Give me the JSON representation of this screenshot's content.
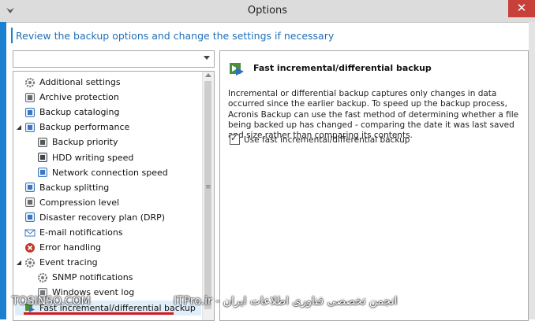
{
  "window": {
    "title": "Options",
    "close_glyph": "✕"
  },
  "header": {
    "text": "Review the backup options and change the settings if necessary"
  },
  "combo": {
    "value": ""
  },
  "tree": {
    "items": [
      {
        "label": "Additional settings",
        "icon": "gear-icon",
        "expander": "",
        "indent": 0
      },
      {
        "label": "Archive protection",
        "icon": "archive-protection-icon",
        "expander": "",
        "indent": 0
      },
      {
        "label": "Backup cataloging",
        "icon": "catalog-icon",
        "expander": "",
        "indent": 0
      },
      {
        "label": "Backup performance",
        "icon": "performance-icon",
        "expander": "◢",
        "indent": 0
      },
      {
        "label": "Backup priority",
        "icon": "priority-icon",
        "expander": "",
        "indent": 1
      },
      {
        "label": "HDD writing speed",
        "icon": "hdd-icon",
        "expander": "",
        "indent": 1
      },
      {
        "label": "Network connection speed",
        "icon": "network-icon",
        "expander": "",
        "indent": 1
      },
      {
        "label": "Backup splitting",
        "icon": "splitting-icon",
        "expander": "",
        "indent": 0
      },
      {
        "label": "Compression level",
        "icon": "compression-icon",
        "expander": "",
        "indent": 0
      },
      {
        "label": "Disaster recovery plan (DRP)",
        "icon": "drp-icon",
        "expander": "",
        "indent": 0
      },
      {
        "label": "E-mail notifications",
        "icon": "email-icon",
        "expander": "",
        "indent": 0
      },
      {
        "label": "Error handling",
        "icon": "error-icon",
        "expander": "",
        "indent": 0
      },
      {
        "label": "Event tracing",
        "icon": "event-tracing-icon",
        "expander": "◢",
        "indent": 0
      },
      {
        "label": "SNMP notifications",
        "icon": "snmp-icon",
        "expander": "",
        "indent": 1
      },
      {
        "label": "Windows event log",
        "icon": "event-log-icon",
        "expander": "",
        "indent": 1
      },
      {
        "label": "Fast incremental/differential backup",
        "icon": "fast-backup-icon",
        "expander": "",
        "indent": 0
      }
    ]
  },
  "panel": {
    "title": "Fast incremental/differential backup",
    "description": "Incremental or differential backup captures only changes in data occurred since the earlier backup. To speed up the backup process, Acronis Backup can use the fast method of determining whether a file being backed up has changed - comparing the date it was last saved and size rather than comparing its contents.",
    "checkbox_label": "Use fast incremental/differential backup",
    "checkbox_checked": true
  },
  "watermark": {
    "left": "TOSINSO.COM",
    "right": "ITPro.ir - انجمن تخصصی فناوری اطلاعات ایران"
  },
  "colors": {
    "accent": "#1a80cf",
    "header_text": "#1f6fb8",
    "close": "#c7403a"
  }
}
